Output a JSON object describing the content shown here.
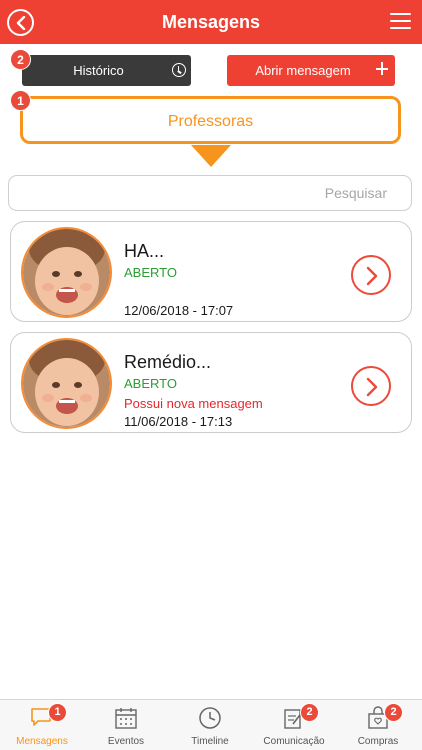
{
  "header": {
    "title": "Mensagens",
    "back_icon": "back-chevron-icon",
    "menu_icon": "hamburger-menu-icon",
    "color": "#ef4133"
  },
  "actions": {
    "historico": {
      "label": "Histórico",
      "badge": "2",
      "icon": "clock-icon",
      "color": "#3a3a3a"
    },
    "abrir": {
      "label": "Abrir mensagem",
      "icon": "plus-icon",
      "color": "#ef4133"
    }
  },
  "tab": {
    "label": "Professoras",
    "badge": "1",
    "color": "#f7941d"
  },
  "search": {
    "placeholder": "Pesquisar",
    "value": ""
  },
  "messages": [
    {
      "title": "HA...",
      "status": "ABERTO",
      "notice": "",
      "datetime": "12/06/2018 - 17:07"
    },
    {
      "title": "Remédio...",
      "status": "ABERTO",
      "notice": "Possui nova mensagem",
      "datetime": "11/06/2018 - 17:13"
    }
  ],
  "status_colors": {
    "open": "#2c9e33",
    "notice": "#e8262c"
  },
  "tabbar": [
    {
      "label": "Mensagens",
      "icon": "chat-bubble-icon",
      "badge": "1",
      "active": true
    },
    {
      "label": "Eventos",
      "icon": "calendar-icon",
      "badge": "",
      "active": false
    },
    {
      "label": "Timeline",
      "icon": "clock-timeline-icon",
      "badge": "",
      "active": false
    },
    {
      "label": "Comunicação",
      "icon": "notepad-pen-icon",
      "badge": "2",
      "active": false
    },
    {
      "label": "Compras",
      "icon": "shopping-bag-icon",
      "badge": "2",
      "active": false
    }
  ]
}
